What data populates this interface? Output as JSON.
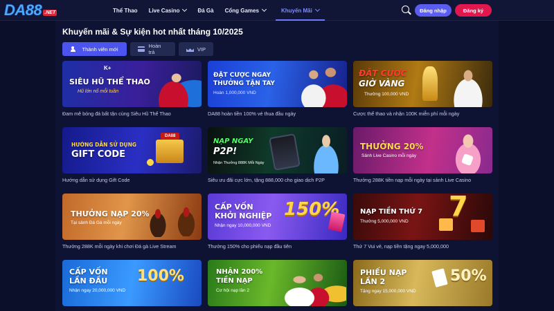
{
  "header": {
    "logo_text": "DA88",
    "logo_suffix": ".NET",
    "nav": [
      {
        "label": "Thể Thao",
        "has_dropdown": false,
        "active": false
      },
      {
        "label": "Live Casino",
        "has_dropdown": true,
        "active": false
      },
      {
        "label": "Đá Gà",
        "has_dropdown": false,
        "active": false
      },
      {
        "label": "Cổng Games",
        "has_dropdown": true,
        "active": false
      },
      {
        "label": "Khuyến Mãi",
        "has_dropdown": true,
        "active": true
      }
    ],
    "login_label": "Đăng nhập",
    "register_label": "Đăng ký"
  },
  "page": {
    "title": "Khuyến mãi & Sự kiện hot nhất tháng 10/2025",
    "tabs": [
      {
        "label": "Thành viên mới",
        "icon": "users-icon",
        "active": true
      },
      {
        "label": "Hoàn trả",
        "icon": "card-icon",
        "active": false
      },
      {
        "label": "VIP",
        "icon": "crown-icon",
        "active": false
      }
    ]
  },
  "promos": [
    {
      "banner_lines": [
        "SIÊU HŨ THỂ THAO"
      ],
      "banner_tagline": "Hũ lớn nổ mỗi tuần",
      "banner_badge": "K+",
      "caption": "Đam mê bóng đá bất tận cùng Siêu Hũ Thể Thao"
    },
    {
      "banner_lines": [
        "ĐẶT CƯỢC NGAY",
        "THƯỞNG TẬN TAY"
      ],
      "banner_tagline": "Hoàn 1,000,000 VND",
      "banner_badge": "",
      "caption": "DA88 hoàn tiền 100% vé thua đầu ngày"
    },
    {
      "banner_lines": [
        "ĐẶT CƯỢC",
        "GIỜ VÀNG"
      ],
      "banner_tagline": "Thưởng 100,000 VND",
      "banner_badge": "",
      "caption": "Cược thể thao và nhận 100K miễn phí mỗi ngày"
    },
    {
      "banner_lines": [
        "HƯỚNG DẪN SỬ DỤNG",
        "GIFT CODE"
      ],
      "banner_tagline": "",
      "banner_badge": "DA88",
      "caption": "Hướng dẫn sử dụng Gift Code"
    },
    {
      "banner_lines": [
        "NẠP NGAY",
        "P2P!"
      ],
      "banner_tagline": "Nhận Thưởng 888K Mỗi Ngày",
      "banner_badge": "",
      "caption": "Siêu ưu đãi cực lớn, tặng 888,000 cho giao dịch P2P"
    },
    {
      "banner_lines": [
        "THƯỞNG 20%"
      ],
      "banner_tagline": "Sảnh Live Casino mỗi ngày",
      "banner_badge": "",
      "caption": "Thưởng 288K tiền nạp mỗi ngày tại sảnh Live Casino"
    },
    {
      "banner_lines": [
        "THƯỞNG NẠP 20%"
      ],
      "banner_tagline": "Tại sảnh Đá Gà mỗi ngày",
      "banner_badge": "",
      "caption": "Thưởng 288K mỗi ngày khi chơi Đá gà Live Stream"
    },
    {
      "banner_lines": [
        "CẤP VỐN",
        "KHỞI NGHIỆP"
      ],
      "banner_tagline": "Nhận ngay 10,000,000 VND",
      "banner_badge": "150%",
      "caption": "Thưởng 150% cho phiếu nạp đầu tiên"
    },
    {
      "banner_lines": [
        "NẠP TIỀN THỨ 7"
      ],
      "banner_tagline": "Thưởng 5,000,000 VND",
      "banner_badge": "7",
      "caption": "Thứ 7 Vui vẻ, nạp tiền tặng ngay 5,000,000"
    },
    {
      "banner_lines": [
        "CẤP VỐN",
        "LẦN ĐẦU"
      ],
      "banner_tagline": "Nhận ngay 20,000,000 VND",
      "banner_badge": "100%",
      "caption": ""
    },
    {
      "banner_lines": [
        "NHẬN 200%",
        "TIỀN NẠP"
      ],
      "banner_tagline": "Cơ hội nạp lần 2",
      "banner_badge": "",
      "caption": ""
    },
    {
      "banner_lines": [
        "PHIẾU NẠP",
        "LẦN 2"
      ],
      "banner_tagline": "Tặng ngay 15,000,000 VND",
      "banner_badge": "50%",
      "caption": ""
    }
  ],
  "colors": {
    "page_bg": "#0c0f2a",
    "panel_bg": "#0f1333",
    "accent": "#5b5cf0",
    "register": "#e0184d"
  }
}
